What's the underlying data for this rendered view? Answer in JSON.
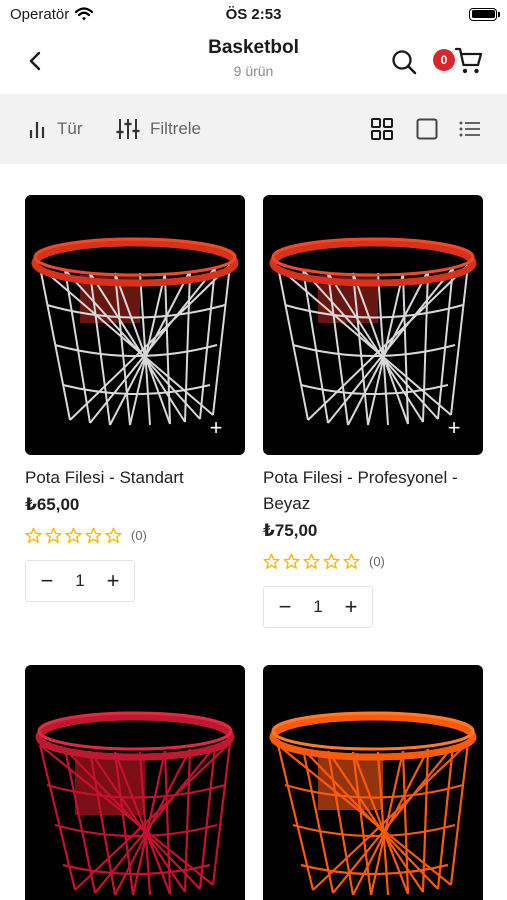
{
  "status_bar": {
    "carrier": "Operatör",
    "time": "ÖS 2:53"
  },
  "header": {
    "title": "Basketbol",
    "subtitle": "9 ürün",
    "cart_count": "0"
  },
  "toolbar": {
    "sort_label": "Tür",
    "filter_label": "Filtrele"
  },
  "products": [
    {
      "name": "Pota Filesi - Standart",
      "price": "₺65,00",
      "rating_count": "(0)",
      "quantity": "1",
      "net_color": "#d8d8d8",
      "rim_color": "#d8321c"
    },
    {
      "name": "Pota Filesi - Profesyonel - Beyaz",
      "price": "₺75,00",
      "rating_count": "(0)",
      "quantity": "1",
      "net_color": "#d8d8d8",
      "rim_color": "#d8321c"
    },
    {
      "name": "",
      "price": "",
      "rating_count": "",
      "quantity": "",
      "net_color": "#c8102e",
      "rim_color": "#c01830"
    },
    {
      "name": "",
      "price": "",
      "rating_count": "",
      "quantity": "",
      "net_color": "#ff5a0a",
      "rim_color": "#ff5a0a"
    }
  ],
  "colors": {
    "accent": "#d9262e",
    "star": "#f5b800",
    "toolbar_bg": "#f2f2f2"
  }
}
